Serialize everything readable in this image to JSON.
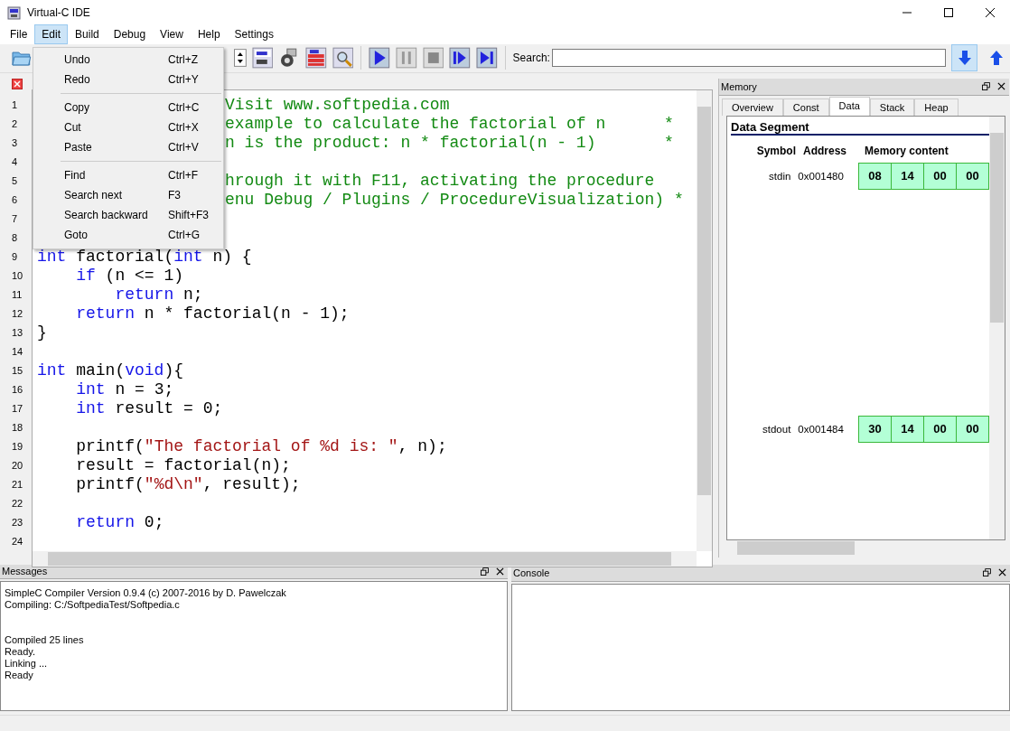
{
  "window": {
    "title": "Virtual-C IDE"
  },
  "menubar": [
    {
      "label": "File",
      "selected": false
    },
    {
      "label": "Edit",
      "selected": true
    },
    {
      "label": "Build",
      "selected": false
    },
    {
      "label": "Debug",
      "selected": false
    },
    {
      "label": "View",
      "selected": false
    },
    {
      "label": "Help",
      "selected": false
    },
    {
      "label": "Settings",
      "selected": false
    }
  ],
  "edit_menu": [
    {
      "kind": "item",
      "label": "Undo",
      "shortcut": "Ctrl+Z"
    },
    {
      "kind": "item",
      "label": "Redo",
      "shortcut": "Ctrl+Y"
    },
    {
      "kind": "separator"
    },
    {
      "kind": "item",
      "label": "Copy",
      "shortcut": "Ctrl+C"
    },
    {
      "kind": "item",
      "label": "Cut",
      "shortcut": "Ctrl+X"
    },
    {
      "kind": "item",
      "label": "Paste",
      "shortcut": "Ctrl+V"
    },
    {
      "kind": "separator"
    },
    {
      "kind": "item",
      "label": "Find",
      "shortcut": "Ctrl+F"
    },
    {
      "kind": "item",
      "label": "Search next",
      "shortcut": "F3"
    },
    {
      "kind": "item",
      "label": "Search backward",
      "shortcut": "Shift+F3"
    },
    {
      "kind": "item",
      "label": "Goto",
      "shortcut": "Ctrl+G"
    }
  ],
  "toolbar": {
    "search_label": "Search:",
    "search_buttons": [
      {
        "kind": "down",
        "selected": true
      },
      {
        "kind": "up",
        "selected": false
      }
    ]
  },
  "editor": {
    "lines": [
      {
        "number": "1",
        "covered": true,
        "segments": [
          {
            "kind": "comment",
            "text": "Visit www.softpedia.com"
          }
        ]
      },
      {
        "number": "2",
        "covered": true,
        "segments": [
          {
            "kind": "comment",
            "text": "example to calculate the factorial of n      *"
          }
        ]
      },
      {
        "number": "3",
        "covered": true,
        "segments": [
          {
            "kind": "comment",
            "text": "n is the product: n * factorial(n - 1)       *"
          }
        ]
      },
      {
        "number": "4"
      },
      {
        "number": "5",
        "covered": true,
        "segments": [
          {
            "kind": "comment",
            "text": "hrough it with F11, activating the procedure"
          }
        ]
      },
      {
        "number": "6",
        "covered": true,
        "segments": [
          {
            "kind": "comment",
            "text": "enu Debug / Plugins / ProcedureVisualization) *"
          }
        ]
      },
      {
        "number": "7"
      },
      {
        "number": "8"
      },
      {
        "number": "9",
        "covered": false,
        "segments": [
          {
            "kind": "keyword",
            "text": "int"
          },
          {
            "kind": "plain",
            "text": " factorial("
          },
          {
            "kind": "keyword",
            "text": "int"
          },
          {
            "kind": "plain",
            "text": " n) {"
          }
        ]
      },
      {
        "number": "10",
        "covered": false,
        "segments": [
          {
            "kind": "keyword",
            "text": "    if"
          },
          {
            "kind": "plain",
            "text": " (n <= 1)"
          }
        ]
      },
      {
        "number": "11",
        "covered": false,
        "segments": [
          {
            "kind": "keyword",
            "text": "        return"
          },
          {
            "kind": "plain",
            "text": " n;"
          }
        ]
      },
      {
        "number": "12",
        "covered": false,
        "segments": [
          {
            "kind": "keyword",
            "text": "    return"
          },
          {
            "kind": "plain",
            "text": " n * factorial(n - 1);"
          }
        ]
      },
      {
        "number": "13",
        "covered": false,
        "segments": [
          {
            "kind": "plain",
            "text": "}"
          }
        ]
      },
      {
        "number": "14"
      },
      {
        "number": "15",
        "covered": false,
        "segments": [
          {
            "kind": "keyword",
            "text": "int"
          },
          {
            "kind": "plain",
            "text": " main("
          },
          {
            "kind": "keyword",
            "text": "void"
          },
          {
            "kind": "plain",
            "text": "){"
          }
        ]
      },
      {
        "number": "16",
        "covered": false,
        "segments": [
          {
            "kind": "keyword",
            "text": "    int"
          },
          {
            "kind": "plain",
            "text": " n = 3;"
          }
        ]
      },
      {
        "number": "17",
        "covered": false,
        "segments": [
          {
            "kind": "keyword",
            "text": "    int"
          },
          {
            "kind": "plain",
            "text": " result = 0;"
          }
        ]
      },
      {
        "number": "18"
      },
      {
        "number": "19",
        "covered": false,
        "segments": [
          {
            "kind": "plain",
            "text": "    printf("
          },
          {
            "kind": "string",
            "text": "\"The factorial of %d is: \""
          },
          {
            "kind": "plain",
            "text": ", n);"
          }
        ]
      },
      {
        "number": "20",
        "covered": false,
        "segments": [
          {
            "kind": "plain",
            "text": "    result = factorial(n);"
          }
        ]
      },
      {
        "number": "21",
        "covered": false,
        "segments": [
          {
            "kind": "plain",
            "text": "    printf("
          },
          {
            "kind": "string",
            "text": "\"%d\\n\""
          },
          {
            "kind": "plain",
            "text": ", result);"
          }
        ]
      },
      {
        "number": "22"
      },
      {
        "number": "23",
        "covered": false,
        "segments": [
          {
            "kind": "keyword",
            "text": "    return"
          },
          {
            "kind": "plain",
            "text": " 0;"
          }
        ]
      },
      {
        "number": "24"
      }
    ]
  },
  "memory": {
    "title": "Memory",
    "tabs": [
      {
        "label": "Overview",
        "selected": false
      },
      {
        "label": "Const",
        "selected": false
      },
      {
        "label": "Data",
        "selected": true
      },
      {
        "label": "Stack",
        "selected": false
      },
      {
        "label": "Heap",
        "selected": false
      }
    ],
    "heading": "Data Segment",
    "columns": [
      "Symbol",
      "Address",
      "Memory content"
    ],
    "rows": [
      {
        "symbol": "stdin",
        "address": "0x001480",
        "bytes": [
          "08",
          "14",
          "00",
          "00"
        ]
      },
      {
        "symbol": "stdout",
        "address": "0x001484",
        "bytes": [
          "30",
          "14",
          "00",
          "00"
        ]
      }
    ]
  },
  "messages": {
    "title": "Messages",
    "blocks": [
      [
        "SimpleC Compiler Version 0.9.4  (c) 2007-2016 by D. Pawelczak",
        "Compiling: C:/SoftpediaTest/Softpedia.c"
      ],
      [
        "Compiled 25 lines",
        "Ready.",
        "Linking ...",
        "Ready"
      ]
    ]
  },
  "console": {
    "title": "Console"
  }
}
